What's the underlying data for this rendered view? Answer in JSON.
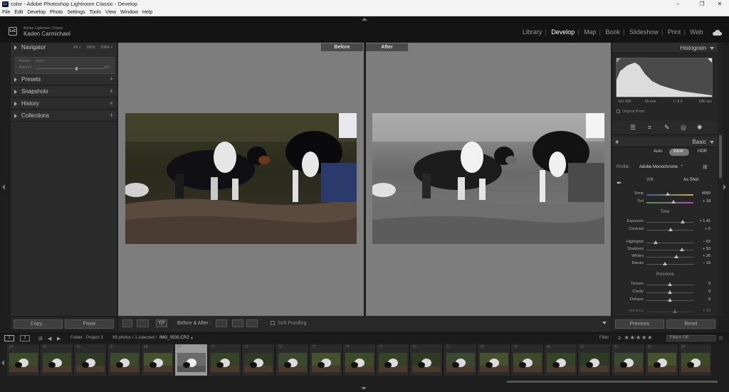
{
  "window": {
    "title": "color - Adobe Photoshop Lightroom Classic - Develop",
    "app_icon": "Lr"
  },
  "menu": [
    "File",
    "Edit",
    "Develop",
    "Photo",
    "Settings",
    "Tools",
    "View",
    "Window",
    "Help"
  ],
  "identity": {
    "logo": "LrC",
    "product": "Adobe Lightroom Classic",
    "user": "Kaden Carmichael"
  },
  "modules": [
    "Library",
    "Develop",
    "Map",
    "Book",
    "Slideshow",
    "Print",
    "Web"
  ],
  "active_module": "Develop",
  "left_panel": {
    "navigator": {
      "label": "Navigator",
      "fit": "Fit",
      "zoom1": "100%",
      "zoom2": "200%",
      "preset_label": "Preset:",
      "preset_value": "None",
      "amount_label": "Amount",
      "amount_value": "100"
    },
    "sections": [
      {
        "label": "Presets",
        "action": "+"
      },
      {
        "label": "Snapshots",
        "action": "+"
      },
      {
        "label": "History",
        "action": "×"
      },
      {
        "label": "Collections",
        "action": "+"
      }
    ],
    "copy": "Copy...",
    "paste": "Paste"
  },
  "viewer": {
    "before_label": "Before",
    "after_label": "After"
  },
  "toolbar": {
    "ba_label": "Before & After :",
    "yy": "Y|Y",
    "soft_proofing": "Soft Proofing"
  },
  "right_panel": {
    "histogram_label": "Histogram",
    "info": {
      "iso": "ISO 200",
      "focal": "55 mm",
      "aperture": "f / 8.0",
      "shutter": "1/80 sec"
    },
    "original_photo": "Original Photo",
    "basic_label": "Basic",
    "treatment": {
      "auto": "Auto",
      "bw": "B&W",
      "hdr": "HDR"
    },
    "profile_label": "Profile:",
    "profile_value": "Adobe Monochrome",
    "wb_label": "WB:",
    "wb_value": "As Shot",
    "tone_label": "Tone",
    "presence_label": "Presence",
    "sliders": [
      {
        "name": "Temp",
        "value": "4950",
        "pos": 0.45
      },
      {
        "name": "Tint",
        "value": "+ 18",
        "pos": 0.58
      },
      {
        "name": "Exposure",
        "value": "+ 1.41",
        "pos": 0.77
      },
      {
        "name": "Contrast",
        "value": "+ 2",
        "pos": 0.51
      },
      {
        "name": "Highlights",
        "value": "− 62",
        "pos": 0.19
      },
      {
        "name": "Shadows",
        "value": "+ 53",
        "pos": 0.76
      },
      {
        "name": "Whites",
        "value": "+ 26",
        "pos": 0.63
      },
      {
        "name": "Blacks",
        "value": "− 19",
        "pos": 0.4
      },
      {
        "name": "Texture",
        "value": "0",
        "pos": 0.5
      },
      {
        "name": "Clarity",
        "value": "0",
        "pos": 0.5
      },
      {
        "name": "Dehaze",
        "value": "0",
        "pos": 0.5
      },
      {
        "name": "Vibrance",
        "value": "+ 20",
        "pos": 0.6
      }
    ],
    "previous": "Previous",
    "reset": "Reset"
  },
  "filmbar": {
    "monitor1": "1",
    "monitor2": "2",
    "folder": "Folder : Project 3",
    "count": "89 photos / 1 selected /",
    "filename": "IMG_0530.CR2",
    "filter_label": "Filter :",
    "filter_value": "Filters Off"
  },
  "filmstrip": [
    {
      "num": "64",
      "sel": false
    },
    {
      "num": "65",
      "sel": false
    },
    {
      "num": "66",
      "sel": false
    },
    {
      "num": "67",
      "sel": false
    },
    {
      "num": "68",
      "sel": false
    },
    {
      "num": "69",
      "sel": true
    },
    {
      "num": "70",
      "sel": false
    },
    {
      "num": "71",
      "sel": false
    },
    {
      "num": "72",
      "sel": false
    },
    {
      "num": "73",
      "sel": false
    },
    {
      "num": "74",
      "sel": false
    },
    {
      "num": "75",
      "sel": false
    },
    {
      "num": "76",
      "sel": false
    },
    {
      "num": "77",
      "sel": false
    },
    {
      "num": "78",
      "sel": false
    },
    {
      "num": "79",
      "sel": false
    },
    {
      "num": "80",
      "sel": false
    },
    {
      "num": "81",
      "sel": false
    },
    {
      "num": "82",
      "sel": false
    },
    {
      "num": "83",
      "sel": false
    },
    {
      "num": "84",
      "sel": false
    }
  ]
}
